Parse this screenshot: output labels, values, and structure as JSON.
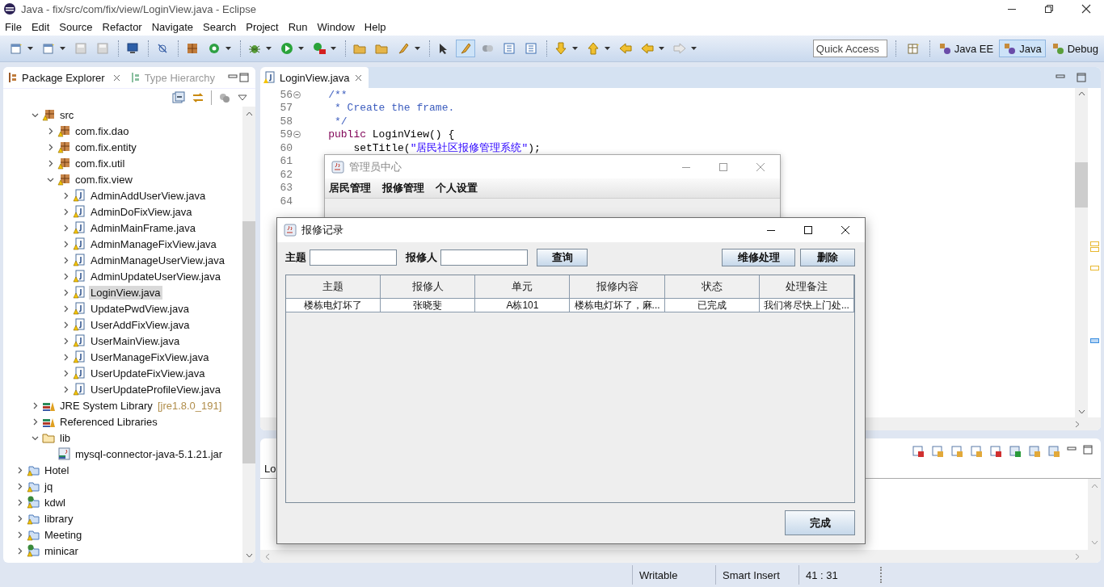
{
  "window": {
    "title": "Java - fix/src/com/fix/view/LoginView.java - Eclipse"
  },
  "menu": [
    "File",
    "Edit",
    "Source",
    "Refactor",
    "Navigate",
    "Search",
    "Project",
    "Run",
    "Window",
    "Help"
  ],
  "quick_access": {
    "placeholder": "Quick Access"
  },
  "perspectives": [
    {
      "label": "Java EE",
      "selected": false
    },
    {
      "label": "Java",
      "selected": true
    },
    {
      "label": "Debug",
      "selected": false
    }
  ],
  "package_explorer": {
    "tabs": [
      {
        "label": "Package Explorer",
        "selected": true
      },
      {
        "label": "Type Hierarchy",
        "selected": false
      }
    ],
    "tree": [
      {
        "label": "src",
        "kind": "source-folder",
        "expanded": true,
        "selected": false,
        "children": [
          {
            "label": "com.fix.dao",
            "kind": "package",
            "expanded": false,
            "selected": false
          },
          {
            "label": "com.fix.entity",
            "kind": "package",
            "expanded": false,
            "selected": false
          },
          {
            "label": "com.fix.util",
            "kind": "package",
            "expanded": false,
            "selected": false
          },
          {
            "label": "com.fix.view",
            "kind": "package",
            "expanded": true,
            "selected": false,
            "children": [
              {
                "label": "AdminAddUserView.java",
                "kind": "java-file",
                "expanded": false,
                "selected": false
              },
              {
                "label": "AdminDoFixView.java",
                "kind": "java-file",
                "expanded": false,
                "selected": false
              },
              {
                "label": "AdminMainFrame.java",
                "kind": "java-file",
                "expanded": false,
                "selected": false
              },
              {
                "label": "AdminManageFixView.java",
                "kind": "java-file",
                "expanded": false,
                "selected": false
              },
              {
                "label": "AdminManageUserView.java",
                "kind": "java-file",
                "expanded": false,
                "selected": false
              },
              {
                "label": "AdminUpdateUserView.java",
                "kind": "java-file",
                "expanded": false,
                "selected": false
              },
              {
                "label": "LoginView.java",
                "kind": "java-file",
                "expanded": false,
                "selected": true
              },
              {
                "label": "UpdatePwdView.java",
                "kind": "java-file",
                "expanded": false,
                "selected": false
              },
              {
                "label": "UserAddFixView.java",
                "kind": "java-file",
                "expanded": false,
                "selected": false
              },
              {
                "label": "UserMainView.java",
                "kind": "java-file",
                "expanded": false,
                "selected": false
              },
              {
                "label": "UserManageFixView.java",
                "kind": "java-file",
                "expanded": false,
                "selected": false
              },
              {
                "label": "UserUpdateFixView.java",
                "kind": "java-file",
                "expanded": false,
                "selected": false
              },
              {
                "label": "UserUpdateProfileView.java",
                "kind": "java-file",
                "expanded": false,
                "selected": false
              }
            ]
          }
        ]
      },
      {
        "label": "JRE System Library",
        "decoration": "[jre1.8.0_191]",
        "kind": "library",
        "expanded": false,
        "selected": false
      },
      {
        "label": "Referenced Libraries",
        "kind": "library",
        "expanded": false,
        "selected": false
      },
      {
        "label": "lib",
        "kind": "folder",
        "expanded": true,
        "selected": false,
        "children": [
          {
            "label": "mysql-connector-java-5.1.21.jar",
            "kind": "jar",
            "selected": false
          }
        ]
      }
    ],
    "projects": [
      {
        "label": "Hotel",
        "kind": "project",
        "expanded": false,
        "selected": false
      },
      {
        "label": "jq",
        "kind": "project",
        "expanded": false,
        "selected": false
      },
      {
        "label": "kdwl",
        "kind": "web-project",
        "expanded": false,
        "selected": false
      },
      {
        "label": "library",
        "kind": "project",
        "expanded": false,
        "selected": false
      },
      {
        "label": "Meeting",
        "kind": "project",
        "expanded": false,
        "selected": false
      },
      {
        "label": "minicar",
        "kind": "web-project",
        "expanded": false,
        "selected": false
      }
    ]
  },
  "editor": {
    "tab": {
      "label": "LoginView.java"
    },
    "lines": [
      {
        "number": "56",
        "fold": true,
        "segments": [
          {
            "text": "    /**",
            "kind": "comment"
          }
        ]
      },
      {
        "number": "57",
        "fold": false,
        "segments": [
          {
            "text": "     * Create the frame.",
            "kind": "comment"
          }
        ]
      },
      {
        "number": "58",
        "fold": false,
        "segments": [
          {
            "text": "     */",
            "kind": "comment"
          }
        ]
      },
      {
        "number": "59",
        "fold": true,
        "segments": [
          {
            "text": "    public",
            "kind": "keyword"
          },
          {
            "text": " LoginView() {",
            "kind": "plain"
          }
        ]
      },
      {
        "number": "60",
        "fold": false,
        "segments": [
          {
            "text": "        setTitle(",
            "kind": "plain"
          },
          {
            "text": "\"居民社区报修管理系统\"",
            "kind": "string"
          },
          {
            "text": ");",
            "kind": "plain"
          }
        ]
      },
      {
        "number": "61",
        "fold": false
      },
      {
        "number": "62",
        "fold": false
      },
      {
        "number": "63",
        "fold": false
      },
      {
        "number": "64",
        "fold": false
      }
    ]
  },
  "console": {
    "tab": {
      "label": "Lo"
    }
  },
  "admin_window": {
    "title": "管理员中心",
    "menu": [
      "居民管理",
      "报修管理",
      "个人设置"
    ]
  },
  "dialog": {
    "title": "报修记录",
    "filters": [
      {
        "label": "主题"
      },
      {
        "label": "报修人"
      }
    ],
    "search_button": "查询",
    "actions": [
      "维修处理",
      "删除"
    ],
    "table": {
      "columns": [
        "主题",
        "报修人",
        "单元",
        "报修内容",
        "状态",
        "处理备注"
      ],
      "rows": [
        [
          "楼栋电灯坏了",
          "张晓斐",
          "A栋101",
          "楼栋电灯坏了，麻...",
          "已完成",
          "我们将尽快上门处..."
        ]
      ]
    },
    "done_button": "完成"
  },
  "status_bar": [
    "Writable",
    "Smart Insert",
    "41 : 31"
  ]
}
